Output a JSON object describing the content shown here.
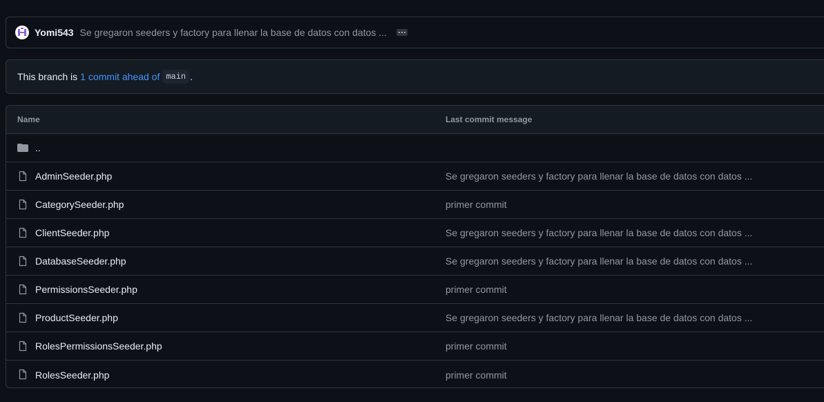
{
  "commit": {
    "author": "Yomi543",
    "message": "Se gregaron seeders y factory para llenar la base de datos con datos ..."
  },
  "branch": {
    "prefix": "This branch is",
    "link": "1 commit ahead of",
    "base": "main",
    "suffix": "."
  },
  "table": {
    "headers": {
      "name": "Name",
      "message": "Last commit message"
    },
    "parent": "..",
    "rows": [
      {
        "name": "AdminSeeder.php",
        "message": "Se gregaron seeders y factory para llenar la base de datos con datos ..."
      },
      {
        "name": "CategorySeeder.php",
        "message": "primer commit"
      },
      {
        "name": "ClientSeeder.php",
        "message": "Se gregaron seeders y factory para llenar la base de datos con datos ..."
      },
      {
        "name": "DatabaseSeeder.php",
        "message": "Se gregaron seeders y factory para llenar la base de datos con datos ..."
      },
      {
        "name": "PermissionsSeeder.php",
        "message": "primer commit"
      },
      {
        "name": "ProductSeeder.php",
        "message": "Se gregaron seeders y factory para llenar la base de datos con datos ..."
      },
      {
        "name": "RolesPermissionsSeeder.php",
        "message": "primer commit"
      },
      {
        "name": "RolesSeeder.php",
        "message": "primer commit"
      }
    ]
  },
  "colors": {
    "accent": "#4493f8",
    "bg": "#0d1117",
    "border": "#30363d",
    "muted": "#9198a1"
  },
  "icons": {
    "folder": "folder-icon",
    "file": "file-icon",
    "avatar": "avatar-identicon",
    "more": "ellipsis-icon"
  }
}
